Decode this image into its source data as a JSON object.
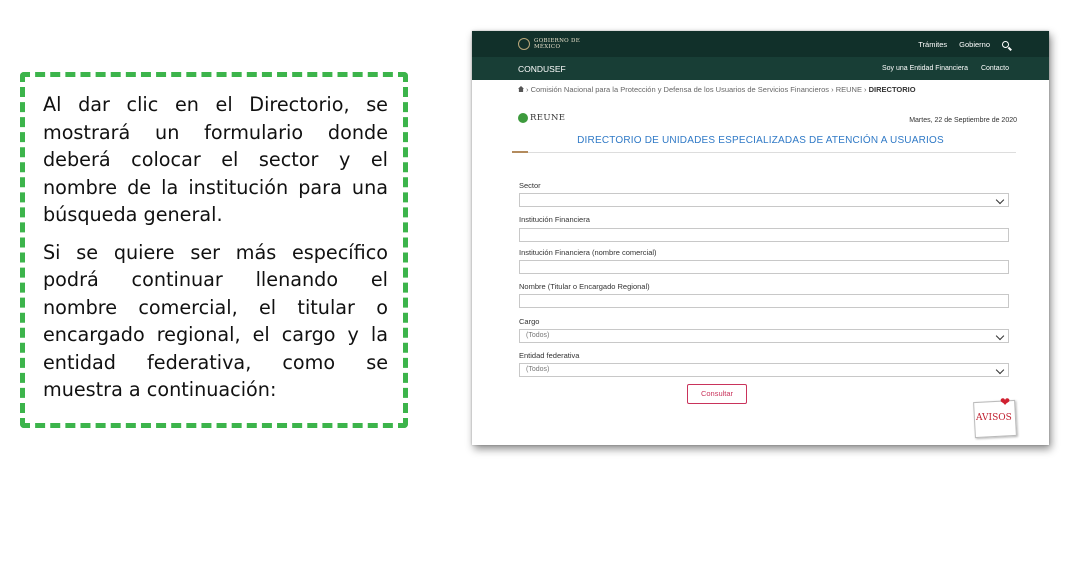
{
  "note": {
    "paragraph1": "Al dar clic en el Directorio, se mostrará un formulario donde deberá colocar el sector y el nombre de la institución para una búsqueda general.",
    "paragraph2": "Si se quiere ser más específico podrá continuar llenando el nombre comercial, el titular o encargado regional, el cargo y la entidad federativa, como se muestra a continuación:"
  },
  "colors": {
    "topbar": "#11302a",
    "subbar": "#183e36",
    "title": "#2f79c6",
    "button": "#c9335b",
    "border": "#3cb44b"
  },
  "topbar": {
    "gov_line1": "GOBIERNO DE",
    "gov_line2": "MÉXICO",
    "nav": [
      "Trámites",
      "Gobierno"
    ]
  },
  "subbar": {
    "brand": "CONDUSEF",
    "nav": [
      "Soy una Entidad Financiera",
      "Contacto"
    ]
  },
  "breadcrumb": {
    "path": "› Comisión Nacional para la Protección y Defensa de los Usuarios de Servicios Financieros › REUNE › ",
    "current": "DIRECTORIO"
  },
  "header": {
    "logo_text": "REUNE",
    "date": "Martes, 22 de Septiembre de 2020",
    "title": "DIRECTORIO DE UNIDADES ESPECIALIZADAS DE ATENCIÓN A USUARIOS"
  },
  "form": {
    "sector_label": "Sector",
    "sector_value": "",
    "institucion_label": "Institución Financiera",
    "nombre_comercial_label": "Institución Financiera (nombre comercial)",
    "titular_label": "Nombre (Titular o Encargado Regional)",
    "cargo_label": "Cargo",
    "cargo_value": "(Todos)",
    "entidad_label": "Entidad federativa",
    "entidad_value": "(Todos)",
    "submit": "Consultar"
  },
  "avisos": {
    "label": "AVISOS"
  }
}
